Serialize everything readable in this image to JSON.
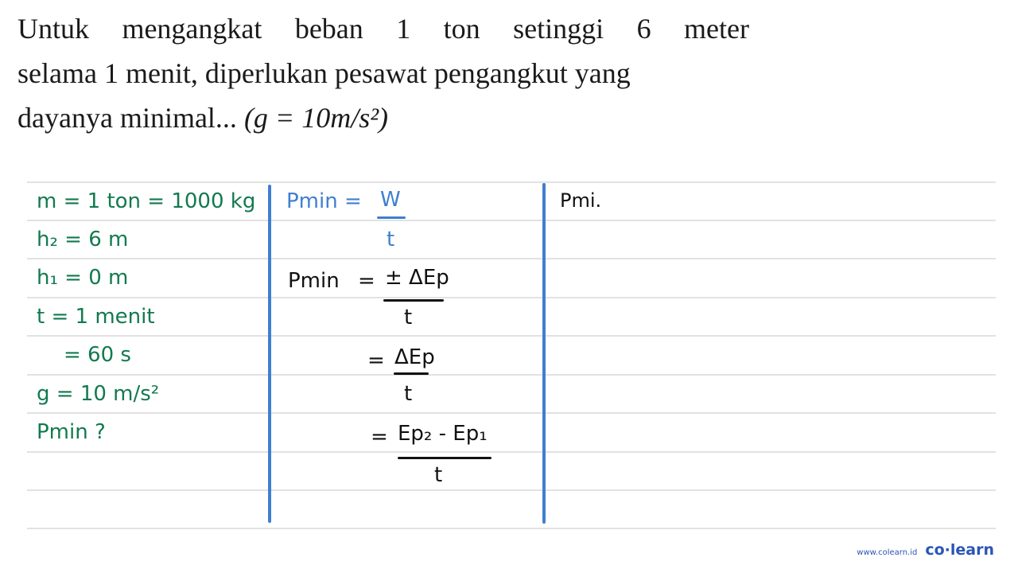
{
  "question": {
    "line1_words": [
      "Untuk",
      "mengangkat",
      "beban",
      "1",
      "ton",
      "setinggi",
      "6",
      "meter"
    ],
    "line2": "selama 1 menit, diperlukan pesawat pengangkut yang",
    "line3_text": "dayanya minimal...",
    "line3_math": "(g = 10m/s²)"
  },
  "known": {
    "mass": "m = 1 ton = 1000 kg",
    "h2": "h₂ = 6 m",
    "h1": "h₁ = 0 m",
    "time": "t = 1 menit",
    "time_seconds": "= 60 s",
    "gravity": "g = 10 m/s²",
    "asked": "Pmin ?"
  },
  "solution": {
    "step1_lhs": "Pmin =",
    "step1_num": "W",
    "step1_den": "t",
    "step2_lhs": "Pmin",
    "step2_eq": "=",
    "step2_num": "± ΔEp",
    "step2_den": "t",
    "step3_eq": "=",
    "step3_num": "ΔEp",
    "step3_den": "t",
    "step4_eq": "=",
    "step4_num": "Ep₂ - Ep₁",
    "step4_den": "t"
  },
  "column3": {
    "partial": "Pmi."
  },
  "colors": {
    "given": "#127a4f",
    "formula": "#3f7fcf",
    "working": "#111111",
    "divider": "#3f7fcf",
    "brand": "#2a55b5"
  },
  "footer": {
    "url": "www.colearn.id",
    "logo": "co·learn"
  }
}
